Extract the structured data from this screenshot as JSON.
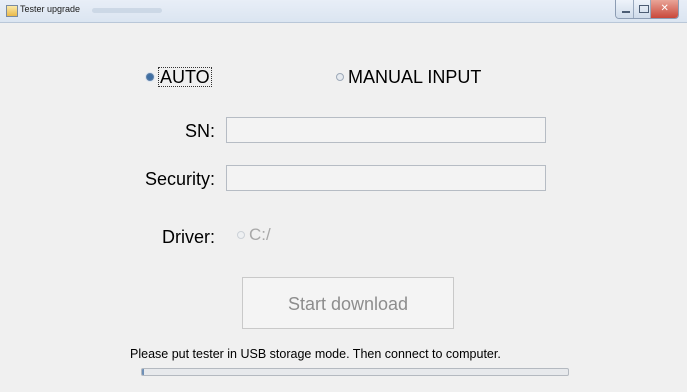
{
  "window": {
    "title": "Tester upgrade"
  },
  "mode": {
    "auto_label": "AUTO",
    "manual_label": "MANUAL INPUT",
    "selected": "AUTO"
  },
  "form": {
    "sn_label": "SN:",
    "sn_value": "",
    "security_label": "Security:",
    "security_value": "",
    "driver_label": "Driver:",
    "driver_option": "C:/"
  },
  "actions": {
    "download_label": "Start download"
  },
  "status": {
    "hint": "Please put tester in USB storage mode. Then connect to computer.",
    "progress": 0.005
  },
  "icons": {
    "app": "app-icon",
    "minimize": "minimize-icon",
    "maximize": "maximize-icon",
    "close": "close-icon"
  }
}
